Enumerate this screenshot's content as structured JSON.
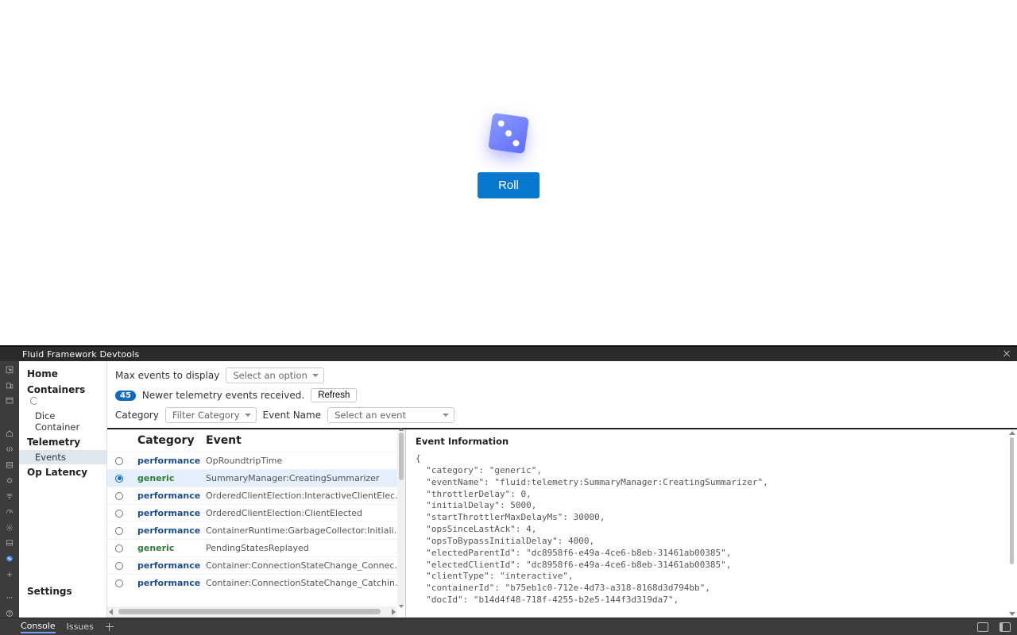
{
  "app": {
    "roll_label": "Roll"
  },
  "devtools": {
    "title": "Fluid Framework Devtools",
    "nav": {
      "home": "Home",
      "containers": "Containers",
      "container_children": [
        "Dice Container"
      ],
      "telemetry": "Telemetry",
      "telemetry_children": [
        "Events"
      ],
      "op_latency": "Op Latency",
      "settings": "Settings"
    },
    "filters": {
      "max_label": "Max events to display",
      "max_placeholder": "Select an option",
      "badge_count": "45",
      "newer_msg": "Newer telemetry events received.",
      "refresh_label": "Refresh",
      "category_label": "Category",
      "category_placeholder": "Filter Category",
      "event_name_label": "Event Name",
      "event_name_placeholder": "Select an event"
    },
    "table": {
      "head_category": "Category",
      "head_event": "Event",
      "rows": [
        {
          "cat": "performance",
          "kind": "perf",
          "ev": "OpRoundtripTime",
          "sel": false
        },
        {
          "cat": "generic",
          "kind": "gen",
          "ev": "SummaryManager:CreatingSummarizer",
          "sel": true
        },
        {
          "cat": "performance",
          "kind": "perf",
          "ev": "OrderedClientElection:InteractiveClientElected",
          "sel": false
        },
        {
          "cat": "performance",
          "kind": "perf",
          "ev": "OrderedClientElection:ClientElected",
          "sel": false
        },
        {
          "cat": "performance",
          "kind": "perf",
          "ev": "ContainerRuntime:GarbageCollector:InitializeOrUpdateGCState_end",
          "sel": false
        },
        {
          "cat": "generic",
          "kind": "gen",
          "ev": "PendingStatesReplayed",
          "sel": false
        },
        {
          "cat": "performance",
          "kind": "perf",
          "ev": "Container:ConnectionStateChange_Connected",
          "sel": false
        },
        {
          "cat": "performance",
          "kind": "perf",
          "ev": "Container:ConnectionStateChange_CatchingUp",
          "sel": false
        }
      ]
    },
    "details": {
      "title": "Event Information",
      "json_lines": [
        "{",
        "  \"category\": \"generic\",",
        "  \"eventName\": \"fluid:telemetry:SummaryManager:CreatingSummarizer\",",
        "  \"throttlerDelay\": 0,",
        "  \"initialDelay\": 5000,",
        "  \"startThrottlerMaxDelayMs\": 30000,",
        "  \"opsSinceLastAck\": 4,",
        "  \"opsToBypassInitialDelay\": 4000,",
        "  \"electedParentId\": \"dc8958f6-e49a-4ce6-b8eb-31461ab00385\",",
        "  \"electedClientId\": \"dc8958f6-e49a-4ce6-b8eb-31461ab00385\",",
        "  \"clientType\": \"interactive\",",
        "  \"containerId\": \"b75eb1c0-712e-4d73-a318-8168d3d794bb\",",
        "  \"docId\": \"b14d4f48-718f-4255-b2e5-144f3d319da7\","
      ]
    }
  },
  "bottom": {
    "console": "Console",
    "issues": "Issues"
  },
  "chart_data": {
    "type": "table",
    "columns": [
      "Category",
      "Event"
    ],
    "rows": [
      [
        "performance",
        "OpRoundtripTime"
      ],
      [
        "generic",
        "SummaryManager:CreatingSummarizer"
      ],
      [
        "performance",
        "OrderedClientElection:InteractiveClientElected"
      ],
      [
        "performance",
        "OrderedClientElection:ClientElected"
      ],
      [
        "performance",
        "ContainerRuntime:GarbageCollector:InitializeOrUpdateGCState_end"
      ],
      [
        "generic",
        "PendingStatesReplayed"
      ],
      [
        "performance",
        "Container:ConnectionStateChange_Connected"
      ],
      [
        "performance",
        "Container:ConnectionStateChange_CatchingUp"
      ]
    ]
  }
}
